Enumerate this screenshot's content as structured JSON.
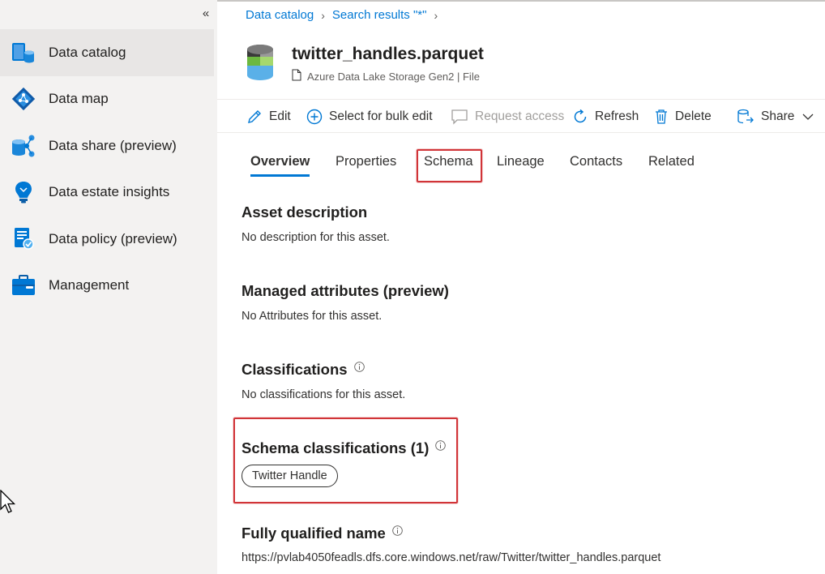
{
  "sidebar": {
    "collapse_glyph": "«",
    "items": [
      {
        "label": "Data catalog",
        "icon": "data-catalog-icon",
        "active": true
      },
      {
        "label": "Data map",
        "icon": "data-map-icon"
      },
      {
        "label": "Data share (preview)",
        "icon": "data-share-icon"
      },
      {
        "label": "Data estate insights",
        "icon": "insights-lightbulb-icon"
      },
      {
        "label": "Data policy (preview)",
        "icon": "data-policy-icon"
      },
      {
        "label": "Management",
        "icon": "management-toolbox-icon"
      }
    ]
  },
  "breadcrumb": {
    "items": [
      "Data catalog",
      "Search results \"*\""
    ]
  },
  "asset": {
    "title": "twitter_handles.parquet",
    "subtitle": "Azure Data Lake Storage Gen2 | File"
  },
  "toolbar": {
    "edit": "Edit",
    "bulk_edit": "Select for bulk edit",
    "request_access": "Request access",
    "refresh": "Refresh",
    "delete": "Delete",
    "share": "Share"
  },
  "tabs": [
    {
      "label": "Overview",
      "active": true
    },
    {
      "label": "Properties"
    },
    {
      "label": "Schema"
    },
    {
      "label": "Lineage"
    },
    {
      "label": "Contacts"
    },
    {
      "label": "Related"
    }
  ],
  "overview": {
    "asset_description": {
      "title": "Asset description",
      "text": "No description for this asset."
    },
    "managed_attributes": {
      "title": "Managed attributes (preview)",
      "text": "No Attributes for this asset."
    },
    "classifications": {
      "title": "Classifications",
      "text": "No classifications for this asset."
    },
    "schema_classifications": {
      "title": "Schema classifications (1)",
      "tags": [
        "Twitter Handle"
      ]
    },
    "fully_qualified_name": {
      "title": "Fully qualified name",
      "text": "https://pvlab4050feadls.dfs.core.windows.net/raw/Twitter/twitter_handles.parquet"
    }
  },
  "colors": {
    "accent": "#0078d4",
    "highlight": "#d13438",
    "sidebar_bg": "#f3f2f1"
  }
}
